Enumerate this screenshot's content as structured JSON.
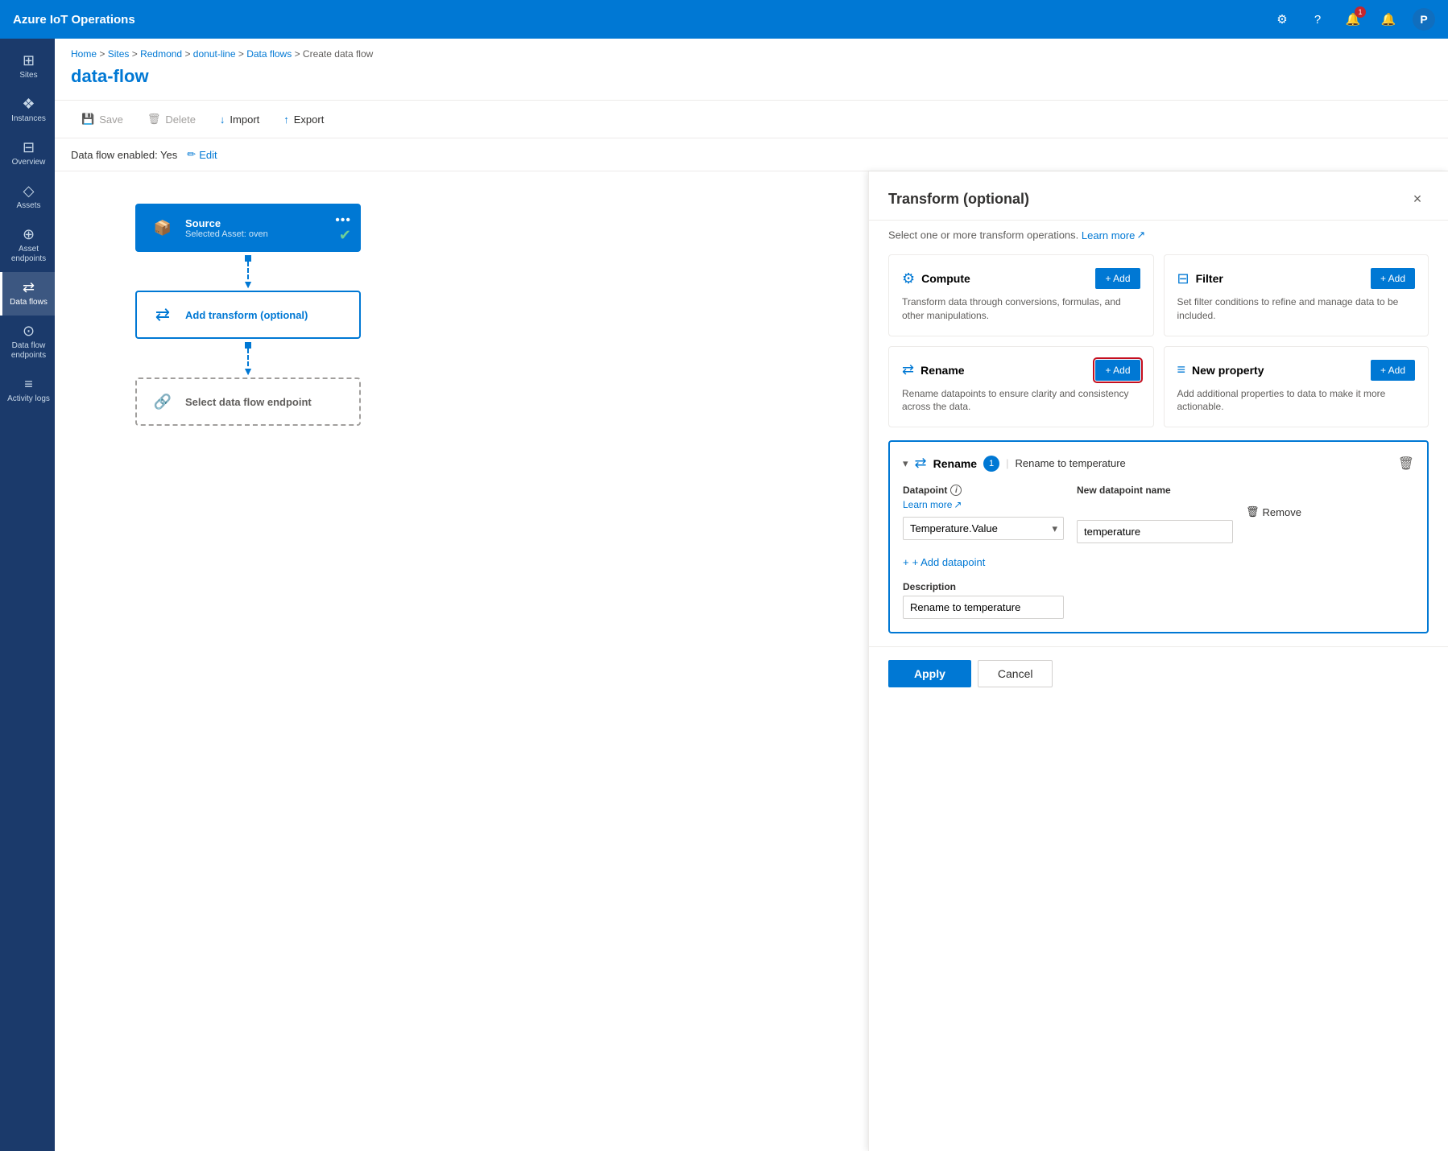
{
  "app": {
    "title": "Azure IoT Operations",
    "avatar": "P"
  },
  "notifications": {
    "count": "1"
  },
  "breadcrumb": {
    "items": [
      "Home",
      "Sites",
      "Redmond",
      "donut-line",
      "Data flows",
      "Create data flow"
    ],
    "separators": [
      ">",
      ">",
      ">",
      ">",
      ">"
    ]
  },
  "page": {
    "title": "data-flow"
  },
  "toolbar": {
    "save_label": "Save",
    "delete_label": "Delete",
    "import_label": "Import",
    "export_label": "Export"
  },
  "status": {
    "label": "Data flow enabled: Yes",
    "edit_label": "Edit"
  },
  "sidebar": {
    "items": [
      {
        "id": "sites",
        "label": "Sites",
        "icon": "⊞"
      },
      {
        "id": "instances",
        "label": "Instances",
        "icon": "◈"
      },
      {
        "id": "overview",
        "label": "Overview",
        "icon": "⊟"
      },
      {
        "id": "assets",
        "label": "Assets",
        "icon": "◇"
      },
      {
        "id": "asset-endpoints",
        "label": "Asset endpoints",
        "icon": "⊕"
      },
      {
        "id": "data-flows",
        "label": "Data flows",
        "icon": "⇄",
        "active": true
      },
      {
        "id": "data-flow-endpoints",
        "label": "Data flow endpoints",
        "icon": "⊙"
      },
      {
        "id": "activity-logs",
        "label": "Activity logs",
        "icon": "≡"
      }
    ]
  },
  "flow_diagram": {
    "source": {
      "title": "Source",
      "subtitle": "Selected Asset: oven"
    },
    "transform": {
      "title": "Add transform (optional)"
    },
    "endpoint": {
      "title": "Select data flow endpoint"
    }
  },
  "zoom": {
    "plus": "+",
    "minus": "−",
    "reset": "⊙"
  },
  "transform_panel": {
    "title": "Transform (optional)",
    "subtitle": "Select one or more transform operations.",
    "learn_more": "Learn more",
    "close_label": "×",
    "operations": [
      {
        "id": "compute",
        "icon": "⊞",
        "title": "Compute",
        "description": "Transform data through conversions, formulas, and other manipulations.",
        "add_label": "+ Add"
      },
      {
        "id": "filter",
        "icon": "⊟",
        "title": "Filter",
        "description": "Set filter conditions to refine and manage data to be included.",
        "add_label": "+ Add"
      },
      {
        "id": "rename",
        "icon": "⇄",
        "title": "Rename",
        "description": "Rename datapoints to ensure clarity and consistency across the data.",
        "add_label": "+ Add",
        "highlighted": true
      },
      {
        "id": "new-property",
        "icon": "≡",
        "title": "New property",
        "description": "Add additional properties to data to make it more actionable.",
        "add_label": "+ Add"
      }
    ],
    "rename_section": {
      "title": "Rename",
      "badge": "1",
      "description": "Rename to temperature",
      "datapoint_label": "Datapoint",
      "learn_more": "Learn more",
      "new_name_label": "New datapoint name",
      "datapoint_value": "Temperature.Value",
      "new_name_value": "temperature",
      "remove_label": "Remove",
      "add_datapoint_label": "+ Add datapoint",
      "description_label": "Description",
      "description_value": "Rename to temperature"
    },
    "footer": {
      "apply_label": "Apply",
      "cancel_label": "Cancel"
    }
  }
}
